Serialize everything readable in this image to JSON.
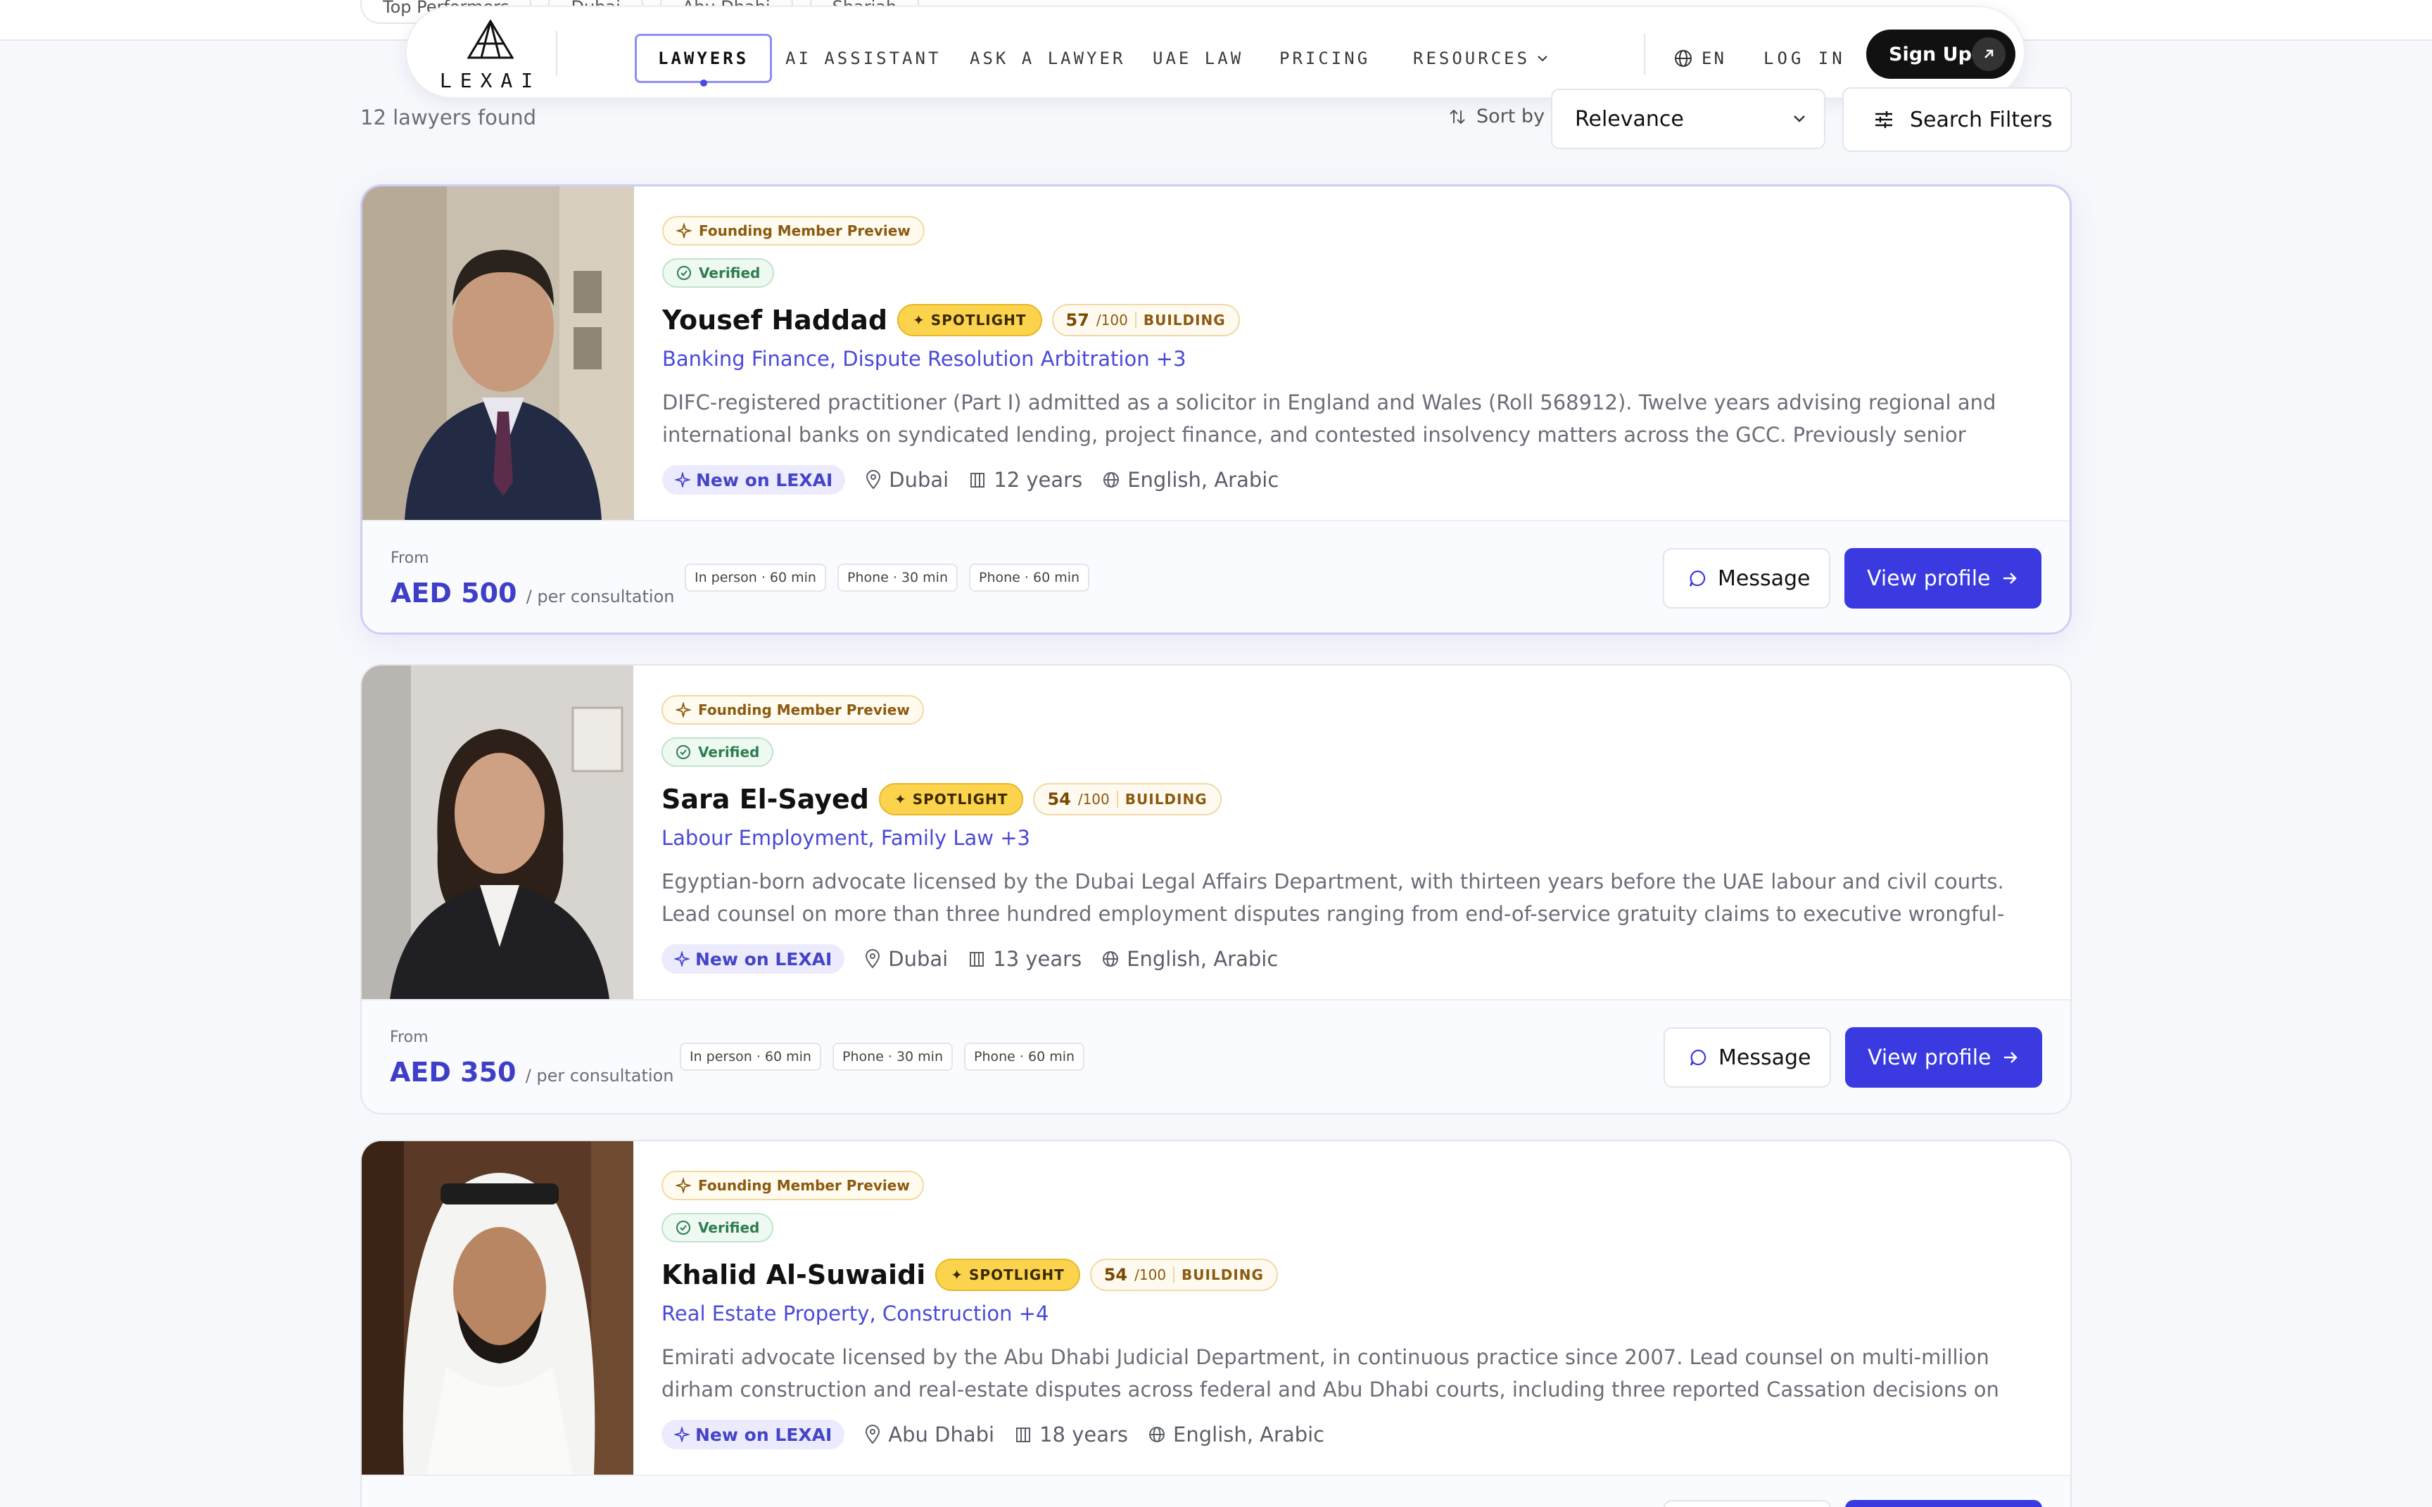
{
  "filter_chips": [
    "Top Performers",
    "Dubai",
    "Abu Dhabi",
    "Shariah"
  ],
  "nav": {
    "logo_text": "LEXAI",
    "items": [
      "LAWYERS",
      "AI ASSISTANT",
      "ASK A LAWYER",
      "UAE LAW",
      "PRICING",
      "RESOURCES"
    ],
    "active_index": 0,
    "lang": "EN",
    "login": "LOG IN",
    "signup": "Sign Up"
  },
  "results": {
    "count_text": "12 lawyers found",
    "sort_label": "Sort by",
    "sort_value": "Relevance",
    "filters_label": "Search Filters"
  },
  "labels": {
    "founding": "Founding Member Preview",
    "verified": "Verified",
    "spotlight": "SPOTLIGHT",
    "score_max": "/100",
    "new": "New on LEXAI",
    "from": "From",
    "per": "/ per consultation",
    "message": "Message",
    "view_profile": "View profile"
  },
  "lawyers": [
    {
      "name": "Yousef Haddad",
      "score": "57",
      "tier": "BUILDING",
      "specialties": "Banking Finance, Dispute Resolution Arbitration +3",
      "description": "DIFC-registered practitioner (Part I) admitted as a solicitor in England and Wales (Roll 568912). Twelve years advising regional and international banks on syndicated lending, project finance, and contested insolvency matters across the GCC. Previously senior associate...",
      "location": "Dubai",
      "experience": "12 years",
      "languages": "English, Arabic",
      "price": "AED 500",
      "slots": [
        "In person · 60 min",
        "Phone · 30 min",
        "Phone · 60 min"
      ]
    },
    {
      "name": "Sara El-Sayed",
      "score": "54",
      "tier": "BUILDING",
      "specialties": "Labour Employment, Family Law +3",
      "description": "Egyptian-born advocate licensed by the Dubai Legal Affairs Department, with thirteen years before the UAE labour and civil courts. Lead counsel on more than three hundred employment disputes ranging from end-of-service gratuity claims to executive wrongful-terminatio...",
      "location": "Dubai",
      "experience": "13 years",
      "languages": "English, Arabic",
      "price": "AED 350",
      "slots": [
        "In person · 60 min",
        "Phone · 30 min",
        "Phone · 60 min"
      ]
    },
    {
      "name": "Khalid Al-Suwaidi",
      "score": "54",
      "tier": "BUILDING",
      "specialties": "Real Estate Property, Construction +4",
      "description": "Emirati advocate licensed by the Abu Dhabi Judicial Department, in continuous practice since 2007. Lead counsel on multi-million dirham construction and real-estate disputes across federal and Abu Dhabi courts, including three reported Cassation decisions on FIDIC-form...",
      "location": "Abu Dhabi",
      "experience": "18 years",
      "languages": "English, Arabic"
    }
  ],
  "colors": {
    "accent": "#3a3ae0",
    "spotlight": "#fcd34d",
    "verified": "#2e7d4f",
    "founding": "#8a5a10"
  }
}
